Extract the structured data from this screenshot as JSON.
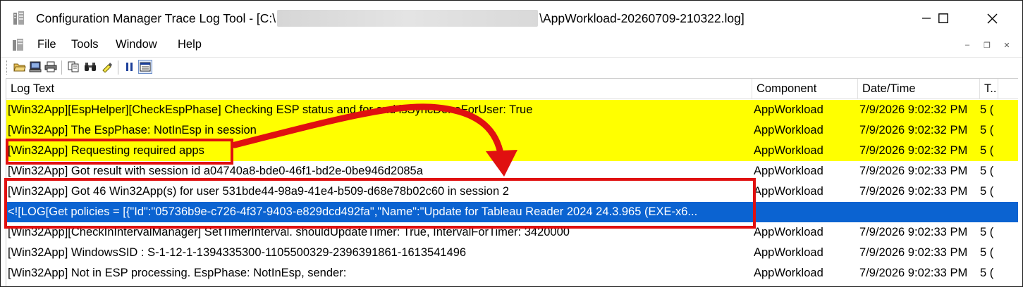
{
  "window": {
    "title_prefix": "Configuration Manager Trace Log Tool - [C:\\",
    "title_suffix": "\\AppWorkload-20260709-210322.log]"
  },
  "menu": {
    "items": [
      "File",
      "Tools",
      "Window",
      "Help"
    ]
  },
  "mdi_controls": {
    "minimize": "–",
    "restore": "❐",
    "close": "✕"
  },
  "columns": {
    "log_text": "Log Text",
    "component": "Component",
    "datetime": "Date/Time",
    "thread": "T.."
  },
  "rows": [
    {
      "text": "[Win32App][EspHelper][CheckEspPhase] Checking ESP status and for and isSyncDoneForUser: True",
      "component": "AppWorkload",
      "datetime": "7/9/2026 9:02:32 PM",
      "thread": "5 ("
    },
    {
      "text": "[Win32App] The EspPhase: NotInEsp in session",
      "component": "AppWorkload",
      "datetime": "7/9/2026 9:02:32 PM",
      "thread": "5 ("
    },
    {
      "text": "[Win32App] Requesting required apps",
      "component": "AppWorkload",
      "datetime": "7/9/2026 9:02:32 PM",
      "thread": "5 ("
    },
    {
      "text": "[Win32App] Got result with session id a04740a8-bde0-46f1-bd2e-0be946d2085a",
      "component": "AppWorkload",
      "datetime": "7/9/2026 9:02:33 PM",
      "thread": "5 ("
    },
    {
      "text": "[Win32App] Got 46 Win32App(s) for user 531bde44-98a9-41e4-b509-d68e78b02c60 in session 2",
      "component": "AppWorkload",
      "datetime": "7/9/2026 9:02:33 PM",
      "thread": "5 ("
    },
    {
      "text": "<![LOG[Get policies = [{\"Id\":\"05736b9e-c726-4f37-9403-e829dcd492fa\",\"Name\":\"Update for Tableau Reader 2024 24.3.965 (EXE-x6...",
      "component": "",
      "datetime": "",
      "thread": ""
    },
    {
      "text": "[Win32App][CheckInIntervalManager] SetTimerInterval. shouldUpdateTimer: True, IntervalForTimer: 3420000",
      "component": "AppWorkload",
      "datetime": "7/9/2026 9:02:33 PM",
      "thread": "5 ("
    },
    {
      "text": "[Win32App] WindowsSID : S-1-12-1-1394335300-1105500329-2396391861-1613541496",
      "component": "AppWorkload",
      "datetime": "7/9/2026 9:02:33 PM",
      "thread": "5 ("
    },
    {
      "text": "[Win32App] Not in ESP processing. EspPhase: NotInEsp, sender:",
      "component": "AppWorkload",
      "datetime": "7/9/2026 9:02:33 PM",
      "thread": "5 ("
    }
  ],
  "row_states": [
    "highlight",
    "highlight",
    "highlight",
    "normal",
    "normal",
    "selected",
    "normal",
    "normal",
    "normal"
  ],
  "colors": {
    "highlight": "#ffff00",
    "selected": "#0b63d1",
    "annotation": "#e01010"
  }
}
